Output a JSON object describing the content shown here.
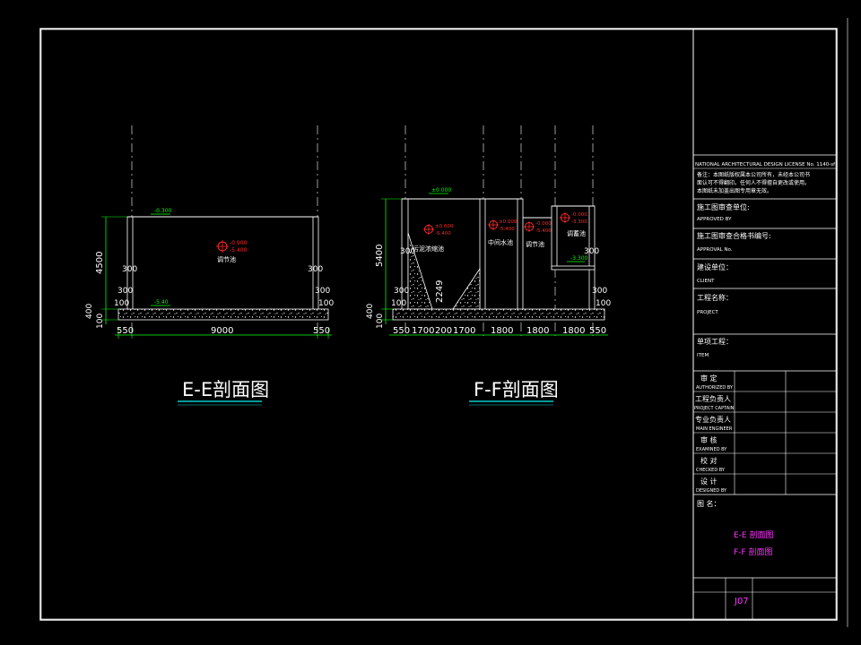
{
  "drawing": {
    "sheet_number": "J07",
    "sections": [
      {
        "id": "E-E",
        "title": "E-E剖面图",
        "tank_label": "调节池",
        "level_top": "-0.900",
        "level_bottom": "-5.400",
        "top_mark": "-0.300",
        "bottom_mark": "-5.40",
        "dims_horizontal": [
          "550",
          "9000",
          "550"
        ],
        "dims_vertical": [
          "4500",
          "400",
          "100"
        ],
        "wall_marks": [
          "300",
          "300",
          "100"
        ]
      },
      {
        "id": "F-F",
        "title": "F-F剖面图",
        "tank_labels": [
          "污泥浓缩池",
          "中间水池",
          "调节池",
          "调蓄池"
        ],
        "level_pairs": [
          [
            "±0.000",
            "-5.400"
          ],
          [
            "±0.000",
            "-5.400"
          ],
          [
            "-0.000",
            "-5.400"
          ],
          [
            "-0.000",
            "-3.300"
          ]
        ],
        "top_mark": "±0.000",
        "inner_mark": "-3.300",
        "slope_mark": "2249",
        "dims_horizontal": [
          "550",
          "1700",
          "200",
          "1700",
          "1800",
          "1800",
          "1800",
          "550"
        ],
        "dims_vertical": [
          "5400",
          "400",
          "100"
        ],
        "wall_marks": [
          "300",
          "300",
          "100"
        ]
      }
    ]
  },
  "title_block": {
    "license": "NATIONAL ARCHITECTURAL DESIGN LICENSE No.  1140-sf",
    "notes": [
      "备注：本图纸版权属本公司所有，未经本公司书",
      "面认可不得翻印。任何人不得擅自更改或使用。",
      "本图纸未加盖出图专用章无效。"
    ],
    "approved_cn": "施工图审查单位:",
    "approved_en": "APPROVED BY",
    "approval_cn": "施工图审查合格书编号:",
    "approval_en": "APPROVAL No.",
    "client_cn": "建设单位：",
    "client_en": "CLIENT",
    "project_cn": "工程名称：",
    "project_en": "PROJECT",
    "item_cn": "单项工程：",
    "item_en": "ITEM",
    "sign_rows": [
      {
        "cn": "审  定",
        "en": "AUTHORIZED BY"
      },
      {
        "cn": "工程负责人",
        "en": "PROJECT CAPTAIN"
      },
      {
        "cn": "专业负责人",
        "en": "MAIN ENGINEER"
      },
      {
        "cn": "审  核",
        "en": "EXAMINED BY"
      },
      {
        "cn": "校  对",
        "en": "CHECKED BY"
      },
      {
        "cn": "设  计",
        "en": "DESIGNED BY"
      }
    ],
    "drawing_name_label": "图  名：",
    "drawing_names": [
      "E-E 剖面图",
      "F-F 剖面图"
    ]
  },
  "colors": {
    "line": "#ffffff",
    "dim": "#00ff00",
    "text": "#ffffff",
    "title_underline": "#00cccc",
    "level_red": "#ff2a2a",
    "magenta": "#ff33ff"
  }
}
